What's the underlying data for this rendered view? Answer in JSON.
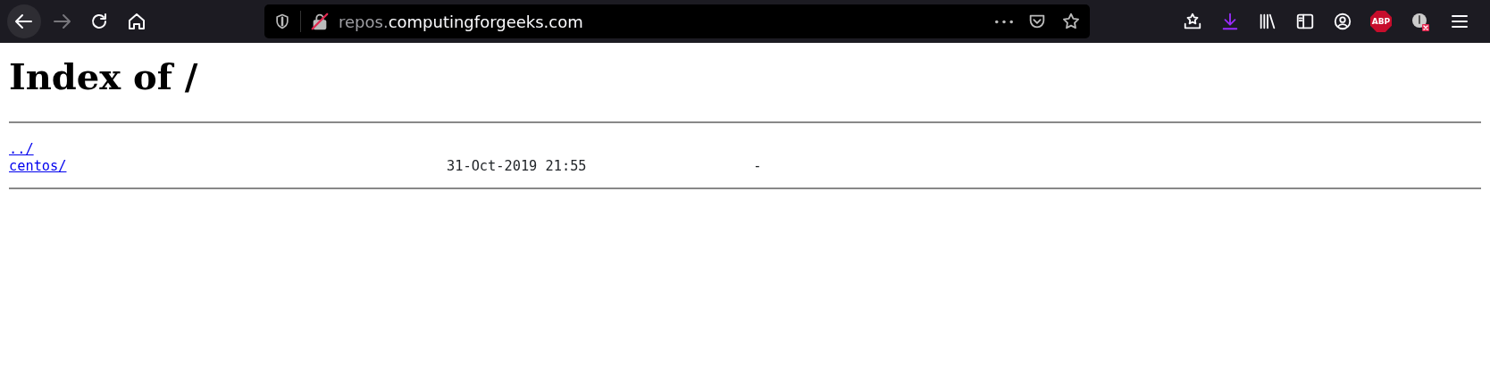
{
  "toolbar": {
    "nav_buttons": [
      {
        "kind": "back",
        "disabled": false
      },
      {
        "kind": "forward",
        "disabled": true
      },
      {
        "kind": "reload",
        "disabled": false
      },
      {
        "kind": "home",
        "disabled": false
      }
    ],
    "address_bar": {
      "url_host_prefix": "repos.",
      "url_domain": "computingforgeeks.com"
    },
    "adblock_badge": "ABP"
  },
  "page": {
    "heading": "Index of /",
    "entries": [
      {
        "name": "../"
      },
      {
        "name": "centos/",
        "modified": "31-Oct-2019 21:55",
        "size": "-"
      }
    ]
  }
}
